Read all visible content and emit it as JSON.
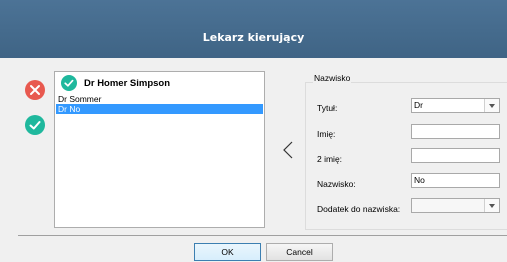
{
  "window": {
    "title": "Lekarz kierujący"
  },
  "physicians": {
    "header": "Dr Homer Simpson",
    "items": [
      {
        "label": "Dr Sommer",
        "selected": false
      },
      {
        "label": "Dr No",
        "selected": true
      }
    ]
  },
  "form": {
    "group_title": "Nazwisko",
    "title_label": "Tytuł:",
    "title_value": "Dr",
    "first_name_label": "Imię:",
    "first_name_value": "",
    "second_name_label": "2 imię:",
    "second_name_value": "",
    "surname_label": "Nazwisko:",
    "surname_value": "No",
    "suffix_label": "Dodatek do nazwiska:",
    "suffix_value": ""
  },
  "buttons": {
    "ok": "OK",
    "cancel": "Cancel"
  },
  "icons": {
    "remove": "close-icon",
    "confirm": "checkmark-icon",
    "transfer": "chevron-left-icon"
  },
  "colors": {
    "titlebar": "#436a8c",
    "remove": "#e8594f",
    "confirm": "#1fb89d",
    "selection": "#3399ff"
  }
}
